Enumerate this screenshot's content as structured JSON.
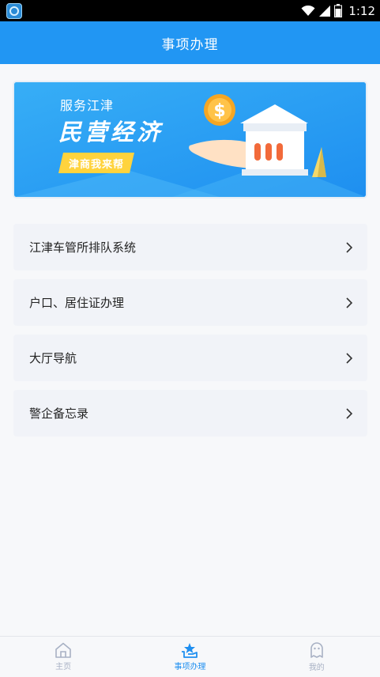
{
  "status_bar": {
    "time": "1:12",
    "icons": [
      "app-icon",
      "wifi-icon",
      "signal-icon",
      "battery-icon"
    ]
  },
  "header": {
    "title": "事项办理"
  },
  "banner": {
    "subtitle": "服务江津",
    "title": "民营经济",
    "tag": "津商我来帮",
    "coin_symbol": "$",
    "colors": {
      "background": "#2aa0f2",
      "tag": "#ffd33d",
      "coin": "#f5a623"
    }
  },
  "menu": {
    "items": [
      {
        "label": "江津车管所排队系统"
      },
      {
        "label": "户口、居住证办理"
      },
      {
        "label": "大厅导航"
      },
      {
        "label": "警企备忘录"
      }
    ]
  },
  "tabbar": {
    "tabs": [
      {
        "label": "主页",
        "icon": "home-icon",
        "active": false
      },
      {
        "label": "事项办理",
        "icon": "star-hand-icon",
        "active": true
      },
      {
        "label": "我的",
        "icon": "profile-icon",
        "active": false
      }
    ],
    "colors": {
      "active": "#1f8ff0",
      "inactive": "#a8b1c4"
    }
  },
  "colors": {
    "primary": "#2196f3",
    "page_bg": "#f7f8fa",
    "item_bg": "#f1f3f8"
  }
}
